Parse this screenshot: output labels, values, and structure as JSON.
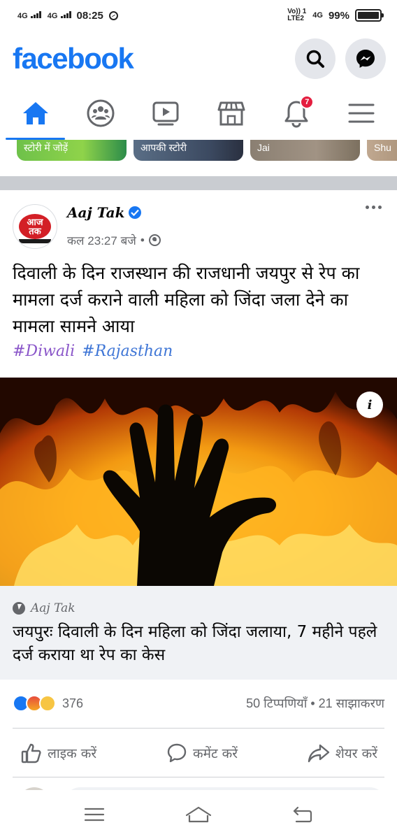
{
  "status_bar": {
    "network_1": "4G",
    "network_2": "4G",
    "time": "08:25",
    "volte": "Vo)) 1\nLTE2",
    "network_3": "4G",
    "battery": "99%"
  },
  "header": {
    "logo": "facebook",
    "icons": [
      "search-icon",
      "messenger-icon"
    ]
  },
  "nav": {
    "tabs": [
      {
        "icon": "home-icon",
        "active": true
      },
      {
        "icon": "groups-icon",
        "active": false
      },
      {
        "icon": "watch-icon",
        "active": false
      },
      {
        "icon": "marketplace-icon",
        "active": false
      },
      {
        "icon": "bell-icon",
        "active": false,
        "badge": "7"
      },
      {
        "icon": "menu-icon",
        "active": false
      }
    ]
  },
  "stories": {
    "items": [
      {
        "label": "स्टोरी में जोड़ें"
      },
      {
        "label": "आपकी स्टोरी"
      },
      {
        "label": "Jai"
      },
      {
        "label": "Shu"
      }
    ]
  },
  "post": {
    "author": "Aaj Tak",
    "avatar_text": "आज\nतक",
    "timestamp": "कल 23:27 बजे",
    "separator": "•",
    "text": "दिवाली के दिन राजस्थान की राजधानी जयपुर से रेप का मामला दर्ज कराने वाली महिला को जिंदा जला देने का मामला सामने आया",
    "hashtags": [
      "#Diwali",
      "#Rajasthan"
    ],
    "image_info_label": "i",
    "link_source": "Aaj Tak",
    "link_title": "जयपुरः दिवाली के दिन महिला को जिंदा जलाया, 7 महीने पहले दर्ज कराया था रेप का केस",
    "reaction_count": "376",
    "engagement": "50 टिप्पणियाँ • 21 साझाकरण",
    "actions": {
      "like": "लाइक करें",
      "comment": "कमेंट करें",
      "share": "शेयर करें"
    }
  },
  "colors": {
    "brand": "#1877f2",
    "badge": "#e41e3f",
    "secondary_text": "#65676b"
  }
}
